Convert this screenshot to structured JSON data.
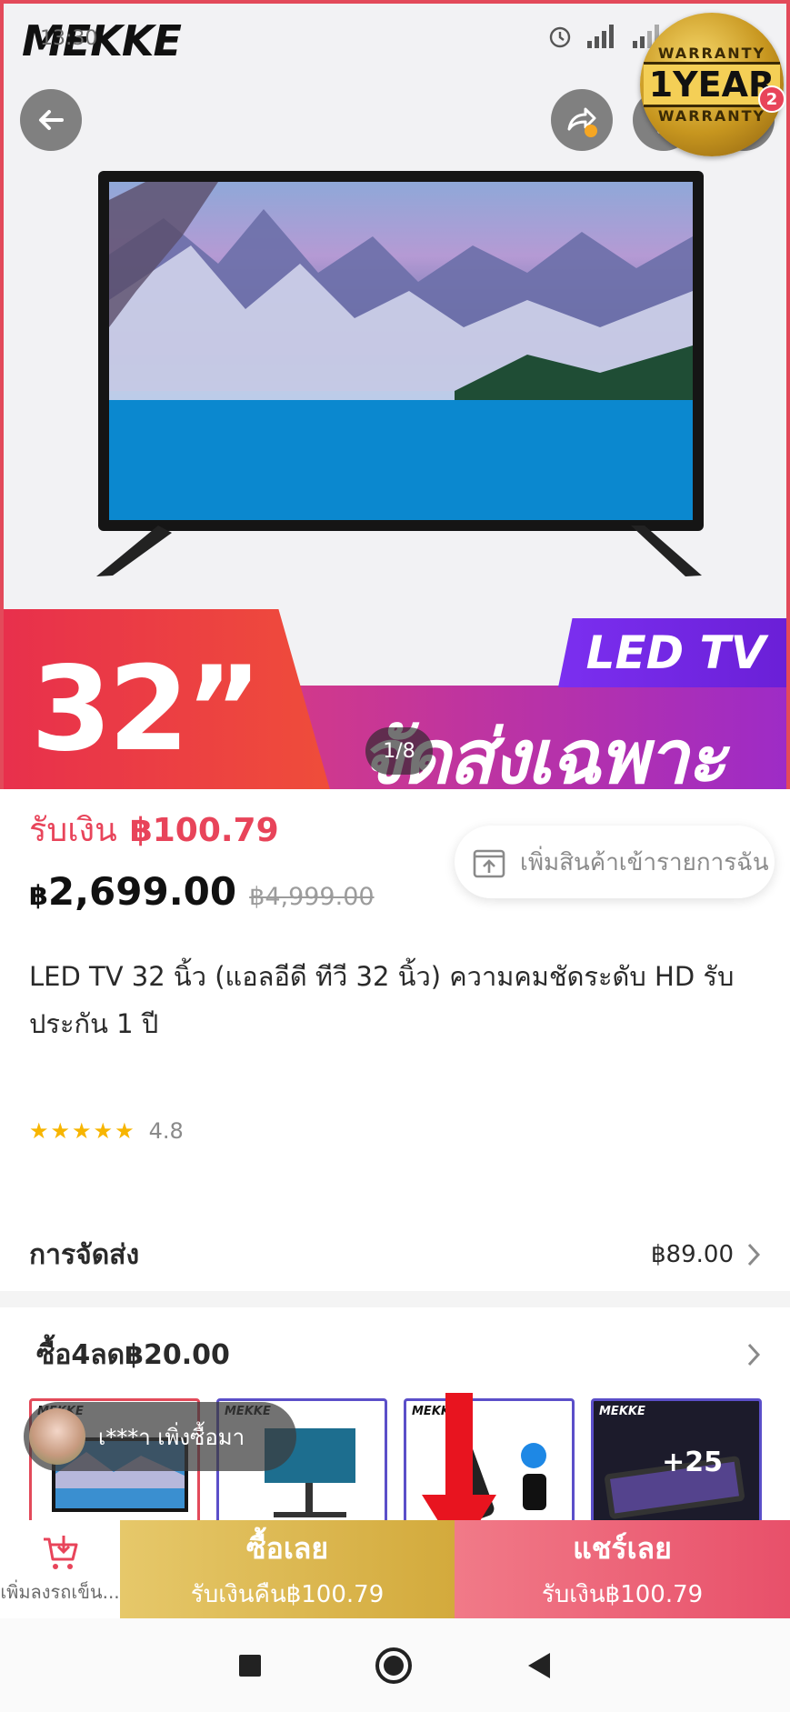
{
  "status_bar": {
    "time": "13:30"
  },
  "hero": {
    "brand": "MEKKE",
    "warranty": {
      "top": "WARRANTY",
      "main": "1YEAR",
      "bottom": "WARRANTY"
    },
    "cart_badge": "2",
    "size_label": "32”",
    "led_tag": "LED TV",
    "banner_text": "จัดส่งเฉพาะจุด",
    "page_indicator": "1/8"
  },
  "product": {
    "cashback_label": "รับเงิน",
    "cashback_amount": "฿100.79",
    "price_currency": "฿",
    "price": "2,699.00",
    "old_price": "฿4,999.00",
    "wishlist_label": "เพิ่มสินค้าเข้ารายการฉัน",
    "title": "LED TV 32 นิ้ว (แอลอีดี ทีวี 32 นิ้ว) ความคมชัดระดับ HD รับประกัน 1 ปี",
    "rating": 4.8,
    "rating_text": "4.8"
  },
  "shipping": {
    "label": "การจัดส่ง",
    "price": "฿89.00"
  },
  "bundle": {
    "label": "ซื้อ4ลด฿20.00",
    "thumb_brand": "MEKKE",
    "more_count": "+25"
  },
  "toast": {
    "text": "เ***า เพิ่งซื้อมา"
  },
  "actions": {
    "add_cart_label": "เพิ่มลงรถเข็น...",
    "buy_now_label": "ซื้อเลย",
    "buy_now_sub": "รับเงินคืน฿100.79",
    "share_label": "แชร์เลย",
    "share_sub": "รับเงิน฿100.79"
  },
  "colors": {
    "accent_red": "#e8445a",
    "buy_gold": "#d3aa3c",
    "share_pink": "#e8506a",
    "star": "#f7b500"
  }
}
